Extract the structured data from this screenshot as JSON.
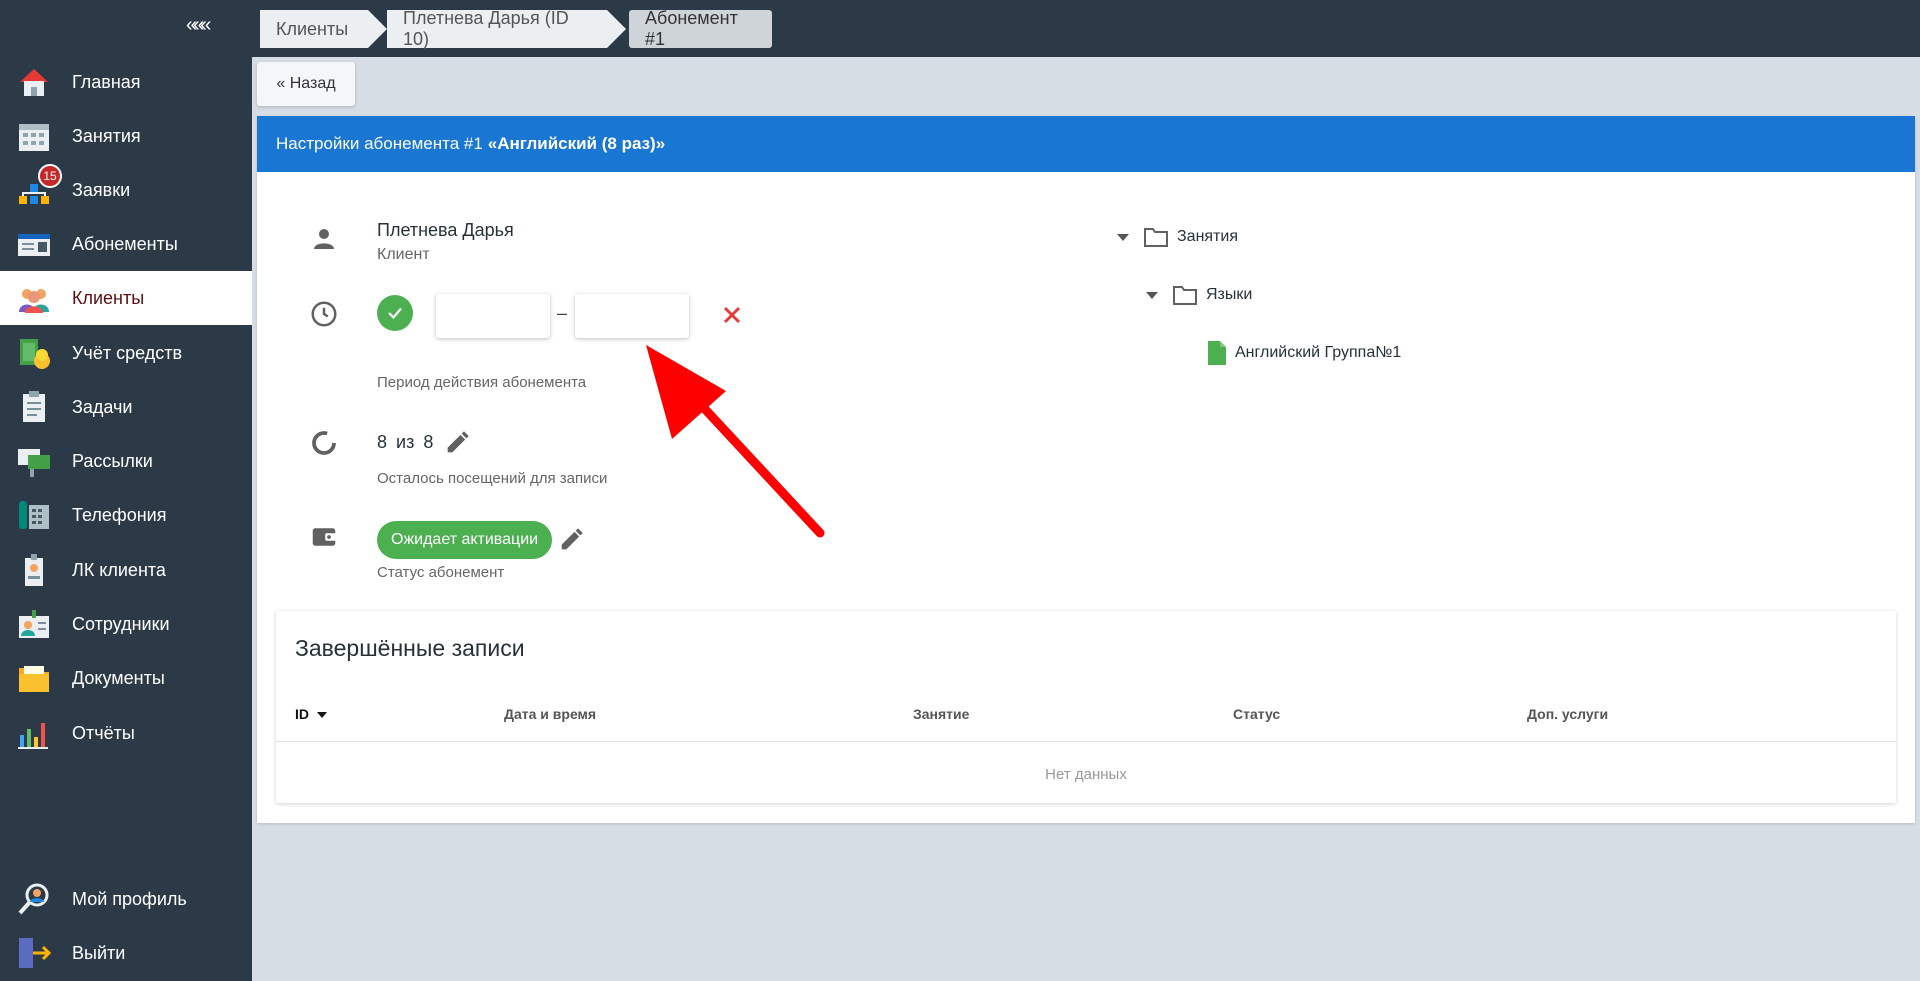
{
  "sidebar": {
    "collapse_label": "«««",
    "items": [
      {
        "label": "Главная",
        "icon": "home-icon"
      },
      {
        "label": "Занятия",
        "icon": "calendar-icon"
      },
      {
        "label": "Заявки",
        "icon": "requests-icon",
        "badge": "15"
      },
      {
        "label": "Абонементы",
        "icon": "id-card-icon"
      },
      {
        "label": "Клиенты",
        "icon": "clients-icon",
        "active": true
      },
      {
        "label": "Учёт средств",
        "icon": "money-icon"
      },
      {
        "label": "Задачи",
        "icon": "clipboard-icon"
      },
      {
        "label": "Рассылки",
        "icon": "mailing-icon"
      },
      {
        "label": "Телефония",
        "icon": "phone-icon"
      },
      {
        "label": "ЛК клиента",
        "icon": "badge-icon"
      },
      {
        "label": "Сотрудники",
        "icon": "staff-icon"
      },
      {
        "label": "Документы",
        "icon": "documents-icon"
      },
      {
        "label": "Отчёты",
        "icon": "reports-icon"
      }
    ],
    "bottom": [
      {
        "label": "Мой профиль",
        "icon": "profile-icon"
      },
      {
        "label": "Выйти",
        "icon": "logout-icon"
      }
    ]
  },
  "breadcrumbs": [
    "Клиенты",
    "Плетнева Дарья (ID 10)",
    "Абонемент #1"
  ],
  "back_label": "« Назад",
  "header": {
    "prefix": "Настройки абонемента #1",
    "name": "«Английский (8 раз)»"
  },
  "client": {
    "name": "Плетнева Дарья",
    "role": "Клиент"
  },
  "period": {
    "start": "",
    "separator": "–",
    "end": "",
    "label": "Период действия абонемента"
  },
  "visits": {
    "text": "8 из 8",
    "label": "Осталось посещений для записи"
  },
  "status": {
    "chip": "Ожидает активации",
    "label": "Статус абонемент"
  },
  "tree": {
    "root": "Занятия",
    "child": "Языки",
    "leaf": "Английский Группа№1"
  },
  "records": {
    "title": "Завершённые записи",
    "columns": [
      "ID",
      "Дата и время",
      "Занятие",
      "Статус",
      "Доп. услуги"
    ],
    "empty": "Нет данных"
  },
  "colors": {
    "sidebar_bg": "#2c3a47",
    "header_blue": "#1976d2",
    "status_green": "#4caf50",
    "clear_red": "#e53935",
    "annotation_red": "#ff0000"
  }
}
